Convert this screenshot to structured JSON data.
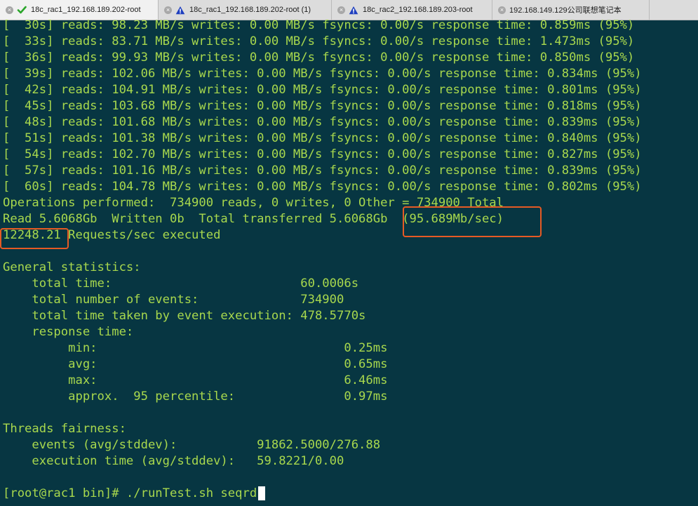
{
  "tabs": [
    {
      "title": "18c_rac1_192.168.189.202-root",
      "status": "check-icon",
      "active": true
    },
    {
      "title": "18c_rac1_192.168.189.202-root (1)",
      "status": "warning-icon",
      "active": false
    },
    {
      "title": "18c_rac2_192.168.189.203-root",
      "status": "warning-icon",
      "active": false
    },
    {
      "title": "192.168.149.129公司联想笔记本",
      "status": "none",
      "active": false
    }
  ],
  "terminal": {
    "lines": [
      "[  30s] reads: 98.23 MB/s writes: 0.00 MB/s fsyncs: 0.00/s response time: 0.859ms (95%)",
      "[  33s] reads: 83.71 MB/s writes: 0.00 MB/s fsyncs: 0.00/s response time: 1.473ms (95%)",
      "[  36s] reads: 99.93 MB/s writes: 0.00 MB/s fsyncs: 0.00/s response time: 0.850ms (95%)",
      "[  39s] reads: 102.06 MB/s writes: 0.00 MB/s fsyncs: 0.00/s response time: 0.834ms (95%)",
      "[  42s] reads: 104.91 MB/s writes: 0.00 MB/s fsyncs: 0.00/s response time: 0.801ms (95%)",
      "[  45s] reads: 103.68 MB/s writes: 0.00 MB/s fsyncs: 0.00/s response time: 0.818ms (95%)",
      "[  48s] reads: 101.68 MB/s writes: 0.00 MB/s fsyncs: 0.00/s response time: 0.839ms (95%)",
      "[  51s] reads: 101.38 MB/s writes: 0.00 MB/s fsyncs: 0.00/s response time: 0.840ms (95%)",
      "[  54s] reads: 102.70 MB/s writes: 0.00 MB/s fsyncs: 0.00/s response time: 0.827ms (95%)",
      "[  57s] reads: 101.16 MB/s writes: 0.00 MB/s fsyncs: 0.00/s response time: 0.839ms (95%)",
      "[  60s] reads: 104.78 MB/s writes: 0.00 MB/s fsyncs: 0.00/s response time: 0.802ms (95%)",
      "Operations performed:  734900 reads, 0 writes, 0 Other = 734900 Total",
      "Read 5.6068Gb  Written 0b  Total transferred 5.6068Gb  (95.689Mb/sec)",
      "12248.21 Requests/sec executed",
      "",
      "General statistics:",
      "    total time:                          60.0006s",
      "    total number of events:              734900",
      "    total time taken by event execution: 478.5770s",
      "    response time:",
      "         min:                                  0.25ms",
      "         avg:                                  0.65ms",
      "         max:                                  6.46ms",
      "         approx.  95 percentile:               0.97ms",
      "",
      "Threads fairness:",
      "    events (avg/stddev):           91862.5000/276.88",
      "    execution time (avg/stddev):   59.8221/0.00",
      "",
      "[root@rac1 bin]# ./runTest.sh seqrd"
    ],
    "text_color": "#a8d84d",
    "background": "#073642",
    "highlight_color": "#e65a24"
  }
}
